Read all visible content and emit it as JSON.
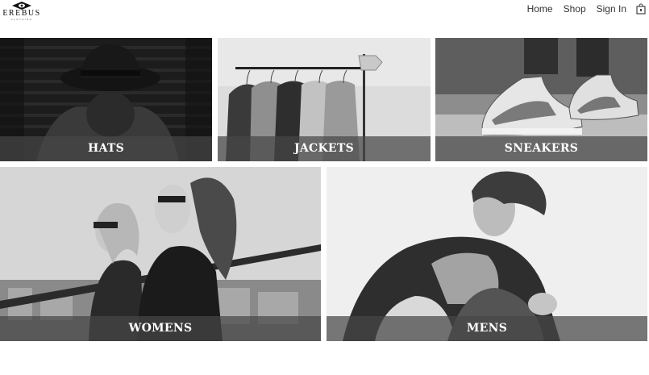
{
  "brand": {
    "name": "EREBUS",
    "tagline": "CLOTHING"
  },
  "nav": {
    "home": "Home",
    "shop": "Shop",
    "sign_in": "Sign In",
    "cart_icon": "shopping-bag-icon"
  },
  "categories": [
    {
      "label": "HATS"
    },
    {
      "label": "JACKETS"
    },
    {
      "label": "SNEAKERS"
    },
    {
      "label": "WOMENS"
    },
    {
      "label": "MENS"
    }
  ],
  "colors": {
    "background": "#ffffff",
    "label_band": "#464646",
    "label_text": "#ffffff"
  }
}
